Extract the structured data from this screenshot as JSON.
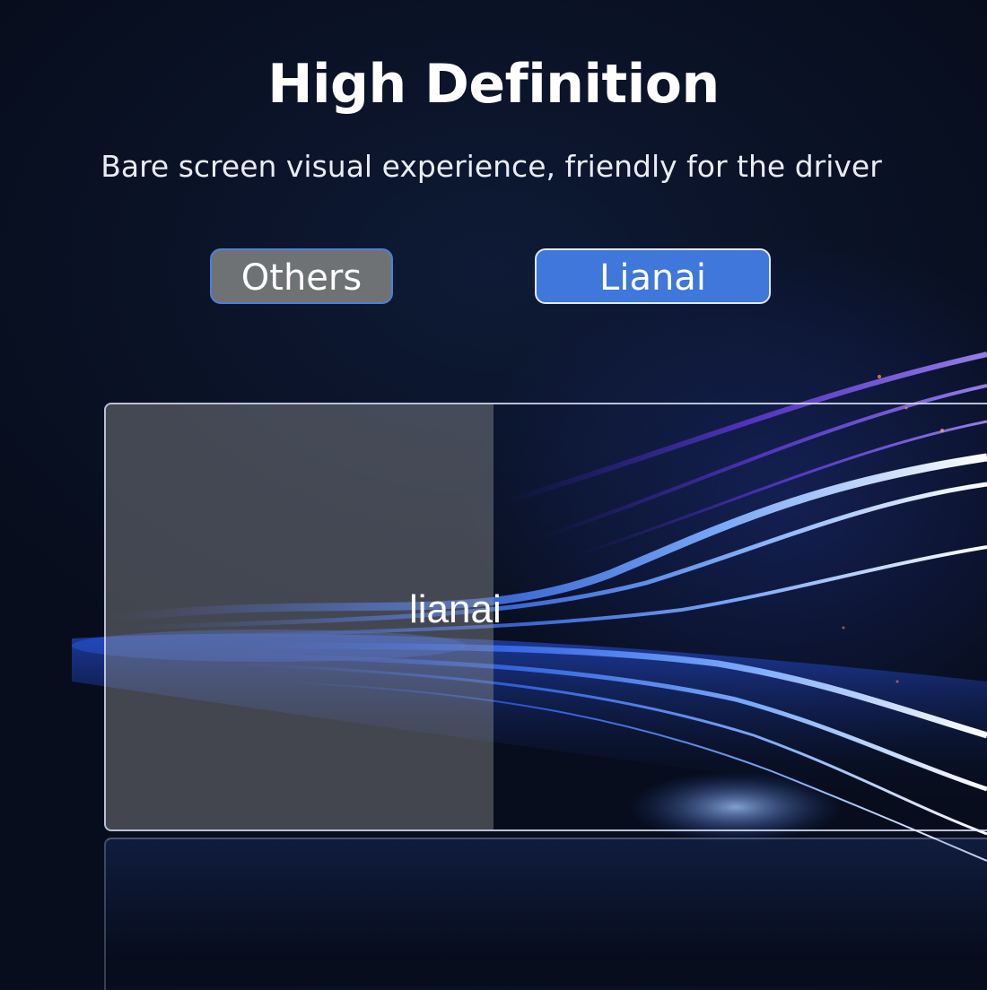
{
  "header": {
    "title": "High Definition",
    "subtitle": "Bare screen visual experience, friendly for the driver"
  },
  "comparison": {
    "left_label": "Others",
    "right_label": "Lianai"
  },
  "screen": {
    "watermark_text": "lianai"
  },
  "colors": {
    "background": "#0a1226",
    "others_tag": "#6f7275",
    "lianai_tag": "#3f77da",
    "light_trails": "#2f6bff"
  }
}
